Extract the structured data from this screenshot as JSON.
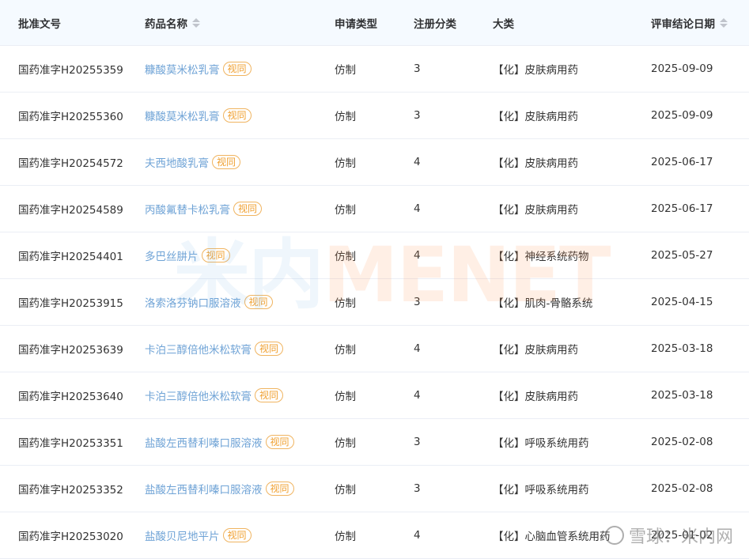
{
  "headers": {
    "approval_no": "批准文号",
    "drug_name": "药品名称",
    "app_type": "申请类型",
    "reg_class": "注册分类",
    "category": "大类",
    "review_date": "评审结论日期"
  },
  "tag_label": "视同",
  "rows": [
    {
      "approval_no": "国药准字H20255359",
      "drug_name": "糠酸莫米松乳膏",
      "app_type": "仿制",
      "reg_class": "3",
      "category": "【化】皮肤病用药",
      "review_date": "2025-09-09"
    },
    {
      "approval_no": "国药准字H20255360",
      "drug_name": "糠酸莫米松乳膏",
      "app_type": "仿制",
      "reg_class": "3",
      "category": "【化】皮肤病用药",
      "review_date": "2025-09-09"
    },
    {
      "approval_no": "国药准字H20254572",
      "drug_name": "夫西地酸乳膏",
      "app_type": "仿制",
      "reg_class": "4",
      "category": "【化】皮肤病用药",
      "review_date": "2025-06-17"
    },
    {
      "approval_no": "国药准字H20254589",
      "drug_name": "丙酸氟替卡松乳膏",
      "app_type": "仿制",
      "reg_class": "4",
      "category": "【化】皮肤病用药",
      "review_date": "2025-06-17"
    },
    {
      "approval_no": "国药准字H20254401",
      "drug_name": "多巴丝肼片",
      "app_type": "仿制",
      "reg_class": "4",
      "category": "【化】神经系统药物",
      "review_date": "2025-05-27"
    },
    {
      "approval_no": "国药准字H20253915",
      "drug_name": "洛索洛芬钠口服溶液",
      "app_type": "仿制",
      "reg_class": "3",
      "category": "【化】肌肉-骨骼系统",
      "review_date": "2025-04-15"
    },
    {
      "approval_no": "国药准字H20253639",
      "drug_name": "卡泊三醇倍他米松软膏",
      "app_type": "仿制",
      "reg_class": "4",
      "category": "【化】皮肤病用药",
      "review_date": "2025-03-18"
    },
    {
      "approval_no": "国药准字H20253640",
      "drug_name": "卡泊三醇倍他米松软膏",
      "app_type": "仿制",
      "reg_class": "4",
      "category": "【化】皮肤病用药",
      "review_date": "2025-03-18"
    },
    {
      "approval_no": "国药准字H20253351",
      "drug_name": "盐酸左西替利嗪口服溶液",
      "app_type": "仿制",
      "reg_class": "3",
      "category": "【化】呼吸系统用药",
      "review_date": "2025-02-08"
    },
    {
      "approval_no": "国药准字H20253352",
      "drug_name": "盐酸左西替利嗪口服溶液",
      "app_type": "仿制",
      "reg_class": "3",
      "category": "【化】呼吸系统用药",
      "review_date": "2025-02-08"
    },
    {
      "approval_no": "国药准字H20253020",
      "drug_name": "盐酸贝尼地平片",
      "app_type": "仿制",
      "reg_class": "4",
      "category": "【化】心脑血管系统用药",
      "review_date": "2025-01-02"
    }
  ],
  "watermark": {
    "left": "米内",
    "right": "MENET"
  },
  "corner_watermark": "雪球：米内网"
}
